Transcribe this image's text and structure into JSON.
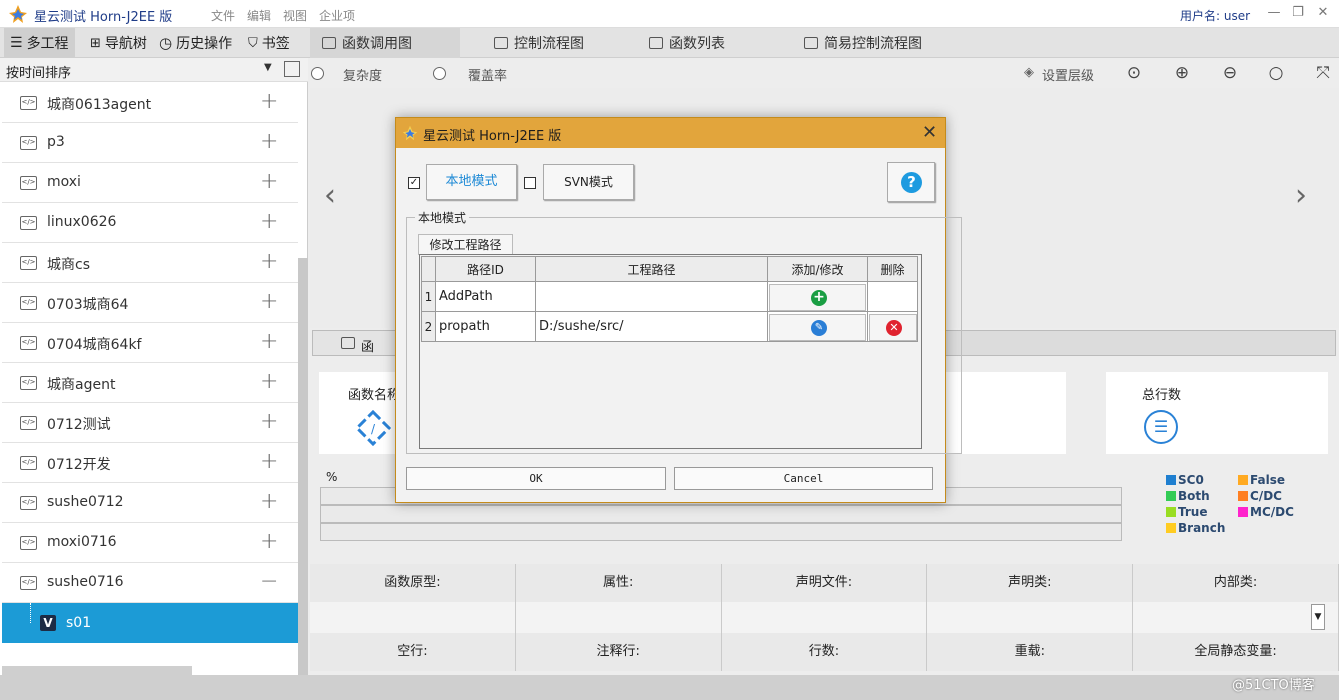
{
  "app": {
    "title": "星云测试 Horn-J2EE 版",
    "menu": [
      "文件",
      "编辑",
      "视图",
      "企业项"
    ],
    "user_label": "用户名: user",
    "window_buttons": [
      "minimize-icon",
      "restore-icon",
      "close-icon"
    ]
  },
  "left_tabs": [
    {
      "label": "多工程",
      "icon": "list-icon",
      "active": true
    },
    {
      "label": "导航树",
      "icon": "tree-icon",
      "active": false
    },
    {
      "label": "历史操作",
      "icon": "clock-icon",
      "active": false
    },
    {
      "label": "书签",
      "icon": "bookmark-icon",
      "active": false
    }
  ],
  "right_tabs": [
    {
      "label": "函数调用图",
      "active": true
    },
    {
      "label": "控制流程图",
      "active": false
    },
    {
      "label": "函数列表",
      "active": false
    },
    {
      "label": "简易控制流程图",
      "active": false
    }
  ],
  "sidebar": {
    "sort_label": "按时间排序",
    "projects": [
      {
        "label": "城商0613agent",
        "toggle": "+"
      },
      {
        "label": "p3",
        "toggle": "+"
      },
      {
        "label": "moxi",
        "toggle": "+"
      },
      {
        "label": "linux0626",
        "toggle": "+"
      },
      {
        "label": "城商cs",
        "toggle": "+"
      },
      {
        "label": "0703城商64",
        "toggle": "+"
      },
      {
        "label": "0704城商64kf",
        "toggle": "+"
      },
      {
        "label": "城商agent",
        "toggle": "+"
      },
      {
        "label": "0712测试",
        "toggle": "+"
      },
      {
        "label": "0712开发",
        "toggle": "+"
      },
      {
        "label": "sushe0712",
        "toggle": "+"
      },
      {
        "label": "moxi0716",
        "toggle": "+"
      },
      {
        "label": "sushe0716",
        "toggle": "−"
      }
    ],
    "selected_child": {
      "label": "s01",
      "icon_letter": "V"
    }
  },
  "toolbar": {
    "radio_complexity": "复杂度",
    "radio_coverage": "覆盖率",
    "layers_label": "设置层级",
    "icons": [
      "zoom-reset-icon",
      "zoom-in-icon",
      "zoom-out-icon",
      "search-icon",
      "fullscreen-icon"
    ]
  },
  "subbar": {
    "tab_label": "函"
  },
  "cards": {
    "func_name_title": "函数名称",
    "total_lines_title": "总行数"
  },
  "coverage": {
    "percent_label": "%",
    "legend": [
      {
        "label": "SC0",
        "color": "#1f7fd0"
      },
      {
        "label": "Both",
        "color": "#33cc55"
      },
      {
        "label": "True",
        "color": "#99dd22"
      },
      {
        "label": "Branch",
        "color": "#ffcc22"
      },
      {
        "label": "False",
        "color": "#ffaa22"
      },
      {
        "label": "C/DC",
        "color": "#ff7f22"
      },
      {
        "label": "MC/DC",
        "color": "#ff22cc"
      }
    ]
  },
  "properties": {
    "row1": [
      "函数原型:",
      "属性:",
      "声明文件:",
      "声明类:",
      "内部类:"
    ],
    "row2": [
      "空行:",
      "注释行:",
      "行数:",
      "重载:",
      "全局静态变量:"
    ]
  },
  "watermark": "@51CTO博客",
  "dialog": {
    "title": "星云测试 Horn-J2EE 版",
    "local_mode_checked": true,
    "local_mode_button": "本地模式",
    "svn_mode_checked": false,
    "svn_mode_button": "SVN模式",
    "group_label": "本地模式",
    "subtab_label": "修改工程路径",
    "columns": [
      "路径ID",
      "工程路径",
      "添加/修改",
      "删除"
    ],
    "rows": [
      {
        "num": "1",
        "path_id": "AddPath",
        "path": "",
        "action": "add-icon",
        "delete": ""
      },
      {
        "num": "2",
        "path_id": "propath",
        "path": "D:/sushe/src/",
        "action": "edit-icon",
        "delete": "delete-icon"
      }
    ],
    "ok_label": "OK",
    "cancel_label": "Cancel"
  }
}
